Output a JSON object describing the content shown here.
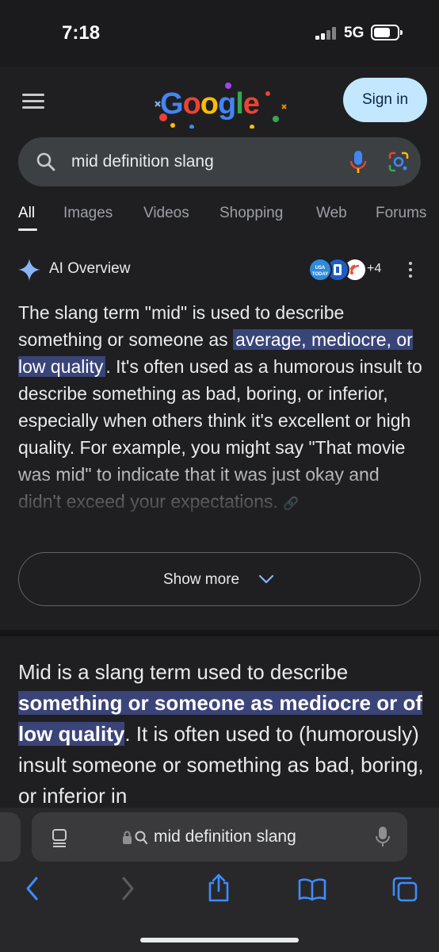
{
  "status_bar": {
    "time": "7:18",
    "network": "5G"
  },
  "header": {
    "logo_text": "Google",
    "sign_in_label": "Sign in"
  },
  "search": {
    "query": "mid definition slang"
  },
  "tabs": [
    {
      "label": "All"
    },
    {
      "label": "Images"
    },
    {
      "label": "Videos"
    },
    {
      "label": "Shopping"
    },
    {
      "label": "Web"
    },
    {
      "label": "Forums"
    }
  ],
  "ai_overview": {
    "title": "AI Overview",
    "source_badge_text": "USA TODAY",
    "more_sources": "+4",
    "text_before": "The slang term \"mid\" is used to describe something or someone as ",
    "highlight": "average, mediocre, or low quality",
    "text_after": ". It's often used as a humorous insult to describe something as bad, boring, or inferior, especially when others think it's excellent or high quality. For example, you might say \"That movie was mid\" to indicate that it was just okay and didn't exceed your expectations.",
    "show_more_label": "Show more"
  },
  "snippet": {
    "text_before": "Mid is a slang term used to describe ",
    "highlight": "something or someone as mediocre or of low quality",
    "text_after": ". It is often used to (humorously) insult someone or something as bad, boring, or inferior in"
  },
  "safari": {
    "address_text": "mid definition slang"
  },
  "colors": {
    "accent_blue": "#3f8cff",
    "highlight": "#394579",
    "sign_in_bg": "#c2e7ff"
  }
}
